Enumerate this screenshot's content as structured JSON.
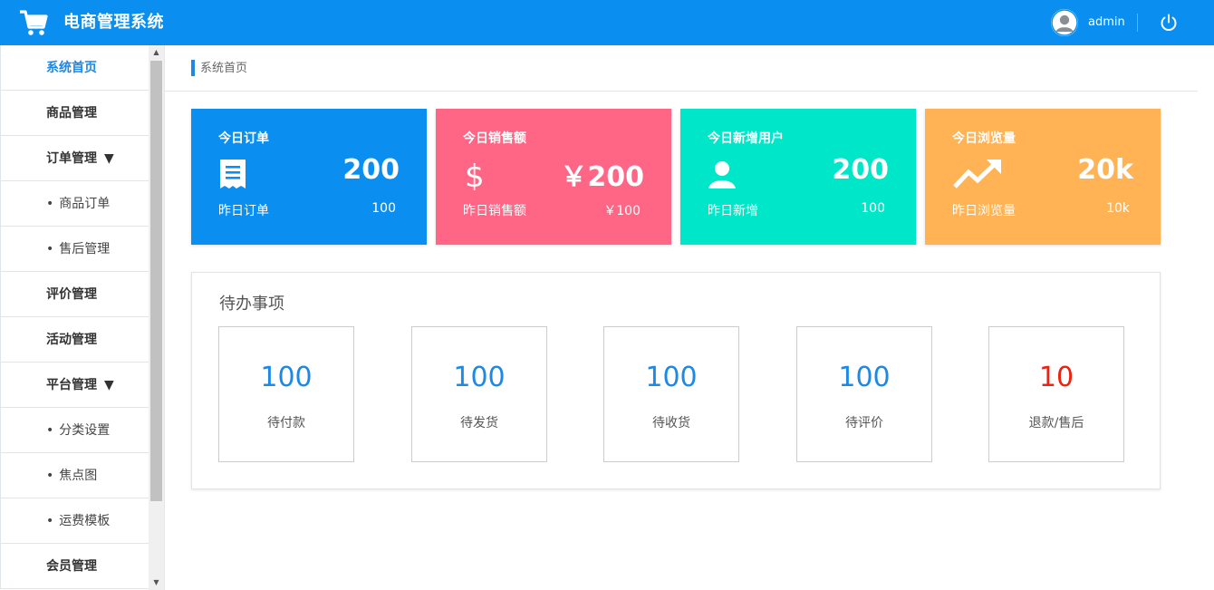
{
  "header": {
    "title": "电商管理系统",
    "username": "admin",
    "icons": {
      "logo": "shopping-cart-icon",
      "avatar": "user-avatar-icon",
      "power": "power-icon"
    },
    "color": "#0a8ff0"
  },
  "breadcrumb": {
    "current": "系统首页"
  },
  "sidebar": {
    "active_color": "#1e88e5",
    "items": [
      {
        "label": "系统首页",
        "type": "top",
        "active": true
      },
      {
        "label": "商品管理",
        "type": "top"
      },
      {
        "label": "订单管理",
        "type": "top",
        "arrow": "▼"
      },
      {
        "label": "商品订单",
        "type": "sub",
        "bullet": "•"
      },
      {
        "label": "售后管理",
        "type": "sub",
        "bullet": "•"
      },
      {
        "label": "评价管理",
        "type": "top"
      },
      {
        "label": "活动管理",
        "type": "top"
      },
      {
        "label": "平台管理",
        "type": "top",
        "arrow": "▼"
      },
      {
        "label": "分类设置",
        "type": "sub",
        "bullet": "•"
      },
      {
        "label": "焦点图",
        "type": "sub",
        "bullet": "•"
      },
      {
        "label": "运费模板",
        "type": "sub",
        "bullet": "•"
      },
      {
        "label": "会员管理",
        "type": "top"
      }
    ]
  },
  "stats": [
    {
      "title": "今日订单",
      "value": "200",
      "sub_label": "昨日订单",
      "sub_value": "100",
      "color": "#0a8ff0",
      "icon": "receipt-icon"
    },
    {
      "title": "今日销售额",
      "value": "￥200",
      "sub_label": "昨日销售额",
      "sub_value": "￥100",
      "color": "#ff6685",
      "icon": "dollar-icon"
    },
    {
      "title": "今日新增用户",
      "value": "200",
      "sub_label": "昨日新增",
      "sub_value": "100",
      "color": "#00e6c8",
      "icon": "user-icon"
    },
    {
      "title": "今日浏览量",
      "value": "20k",
      "sub_label": "昨日浏览量",
      "sub_value": "10k",
      "color": "#ffb354",
      "icon": "trending-up-icon"
    }
  ],
  "todo": {
    "title": "待办事项",
    "items": [
      {
        "value": "100",
        "label": "待付款",
        "color": "#1e88e5"
      },
      {
        "value": "100",
        "label": "待发货",
        "color": "#1e88e5"
      },
      {
        "value": "100",
        "label": "待收货",
        "color": "#1e88e5"
      },
      {
        "value": "100",
        "label": "待评价",
        "color": "#1e88e5"
      },
      {
        "value": "10",
        "label": "退款/售后",
        "color": "#ee2211"
      }
    ]
  }
}
